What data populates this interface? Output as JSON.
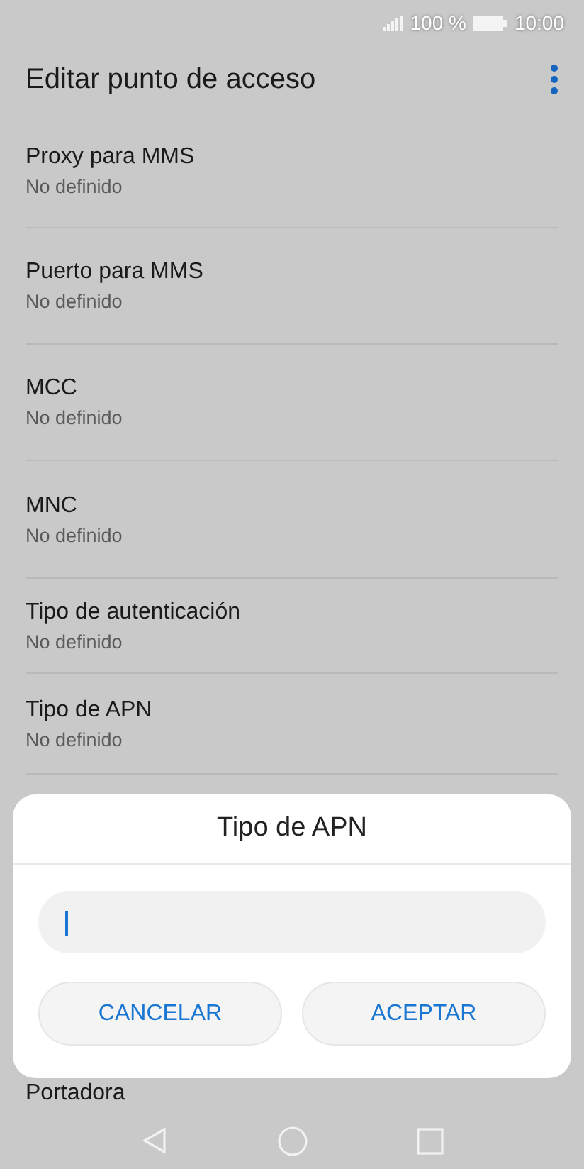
{
  "status_bar": {
    "battery_text": "100 %",
    "time": "10:00"
  },
  "app_bar": {
    "title": "Editar punto de acceso"
  },
  "settings": [
    {
      "title": "Proxy para MMS",
      "value": "No definido"
    },
    {
      "title": "Puerto para MMS",
      "value": "No definido"
    },
    {
      "title": "MCC",
      "value": "No definido"
    },
    {
      "title": "MNC",
      "value": "No definido"
    },
    {
      "title": "Tipo de autenticación",
      "value": "No definido"
    },
    {
      "title": "Tipo de APN",
      "value": "No definido"
    },
    {
      "title": "Portadora"
    }
  ],
  "dialog": {
    "title": "Tipo de APN",
    "buttons": [
      "CANCELAR",
      "ACEPTAR"
    ]
  }
}
